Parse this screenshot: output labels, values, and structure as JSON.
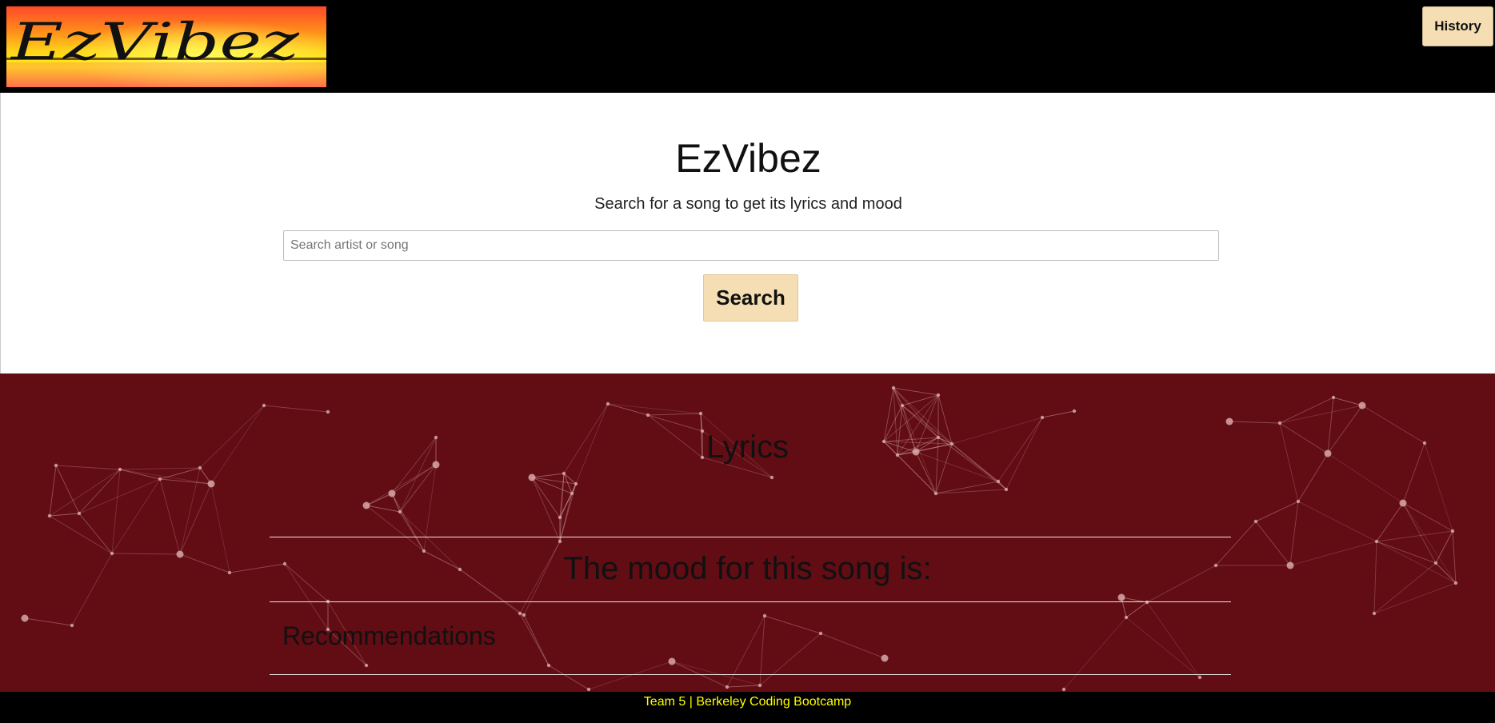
{
  "header": {
    "logo_text": "EzVibez",
    "history_label": "History"
  },
  "search": {
    "title": "EzVibez",
    "subtitle": "Search for a song to get its lyrics and mood",
    "placeholder": "Search artist or song",
    "button_label": "Search"
  },
  "results": {
    "lyrics_heading": "Lyrics",
    "mood_heading": "The mood for this song is:",
    "recommendations_heading": "Recommendations"
  },
  "footer": {
    "text": "Team 5 | Berkeley Coding Bootcamp"
  },
  "colors": {
    "header_bg": "#000000",
    "button_bg": "#f5deb3",
    "results_bg": "#620c14",
    "footer_text": "#ffff00"
  }
}
